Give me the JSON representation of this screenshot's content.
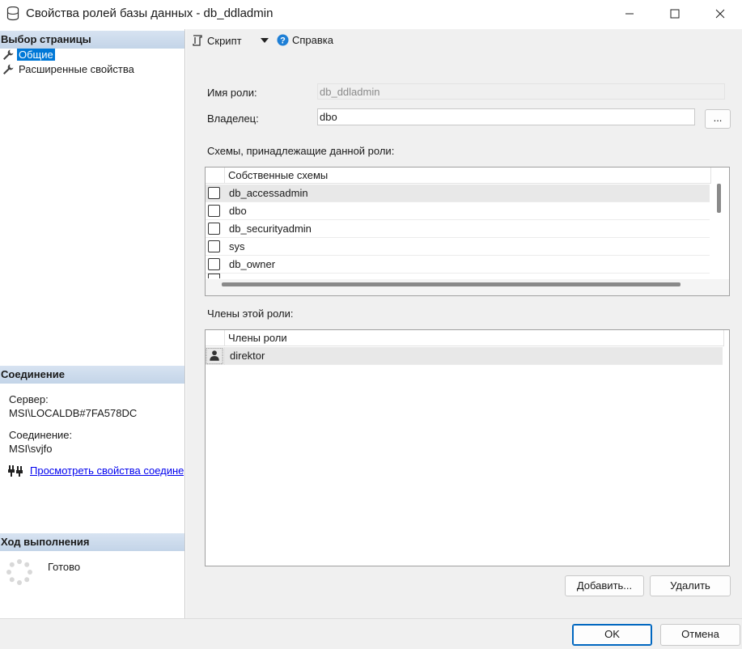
{
  "window": {
    "title": "Свойства ролей базы данных - db_ddladmin",
    "icon": "database-icon"
  },
  "left_panel": {
    "select_page_header": "Выбор страницы",
    "pages": [
      {
        "label": "Общие",
        "icon": "wrench-icon",
        "selected": true
      },
      {
        "label": "Расширенные свойства",
        "icon": "wrench-icon",
        "selected": false
      }
    ],
    "connection_header": "Соединение",
    "server_label": "Сервер:",
    "server_value": "MSI\\LOCALDB#7FA578DC",
    "connection_label": "Соединение:",
    "connection_value": "MSI\\svjfo",
    "view_props_link": "Просмотреть свойства соединения",
    "progress_header": "Ход выполнения",
    "progress_status": "Готово"
  },
  "toolbar": {
    "script_label": "Скрипт",
    "help_label": "Справка"
  },
  "form": {
    "role_name_label": "Имя роли:",
    "role_name_value": "db_ddladmin",
    "owner_label": "Владелец:",
    "owner_value": "dbo",
    "browse_label": "...",
    "schemas_label": "Схемы, принадлежащие данной роли:",
    "schemas_column": "Собственные схемы",
    "schemas": [
      {
        "name": "db_accessadmin",
        "checked": false
      },
      {
        "name": "dbo",
        "checked": false
      },
      {
        "name": "db_securityadmin",
        "checked": false
      },
      {
        "name": "sys",
        "checked": false
      },
      {
        "name": "db_owner",
        "checked": false
      }
    ],
    "members_label": "Члены этой роли:",
    "members_column": "Члены роли",
    "members": [
      {
        "name": "direktor",
        "icon": "user-icon"
      }
    ],
    "add_label": "Добавить...",
    "remove_label": "Удалить"
  },
  "footer": {
    "ok_label": "OK",
    "cancel_label": "Отмена"
  },
  "colors": {
    "selection": "#0078d7",
    "section_header": "#c9d9ec",
    "link": "#0000ee",
    "primary_border": "#0067c0"
  }
}
